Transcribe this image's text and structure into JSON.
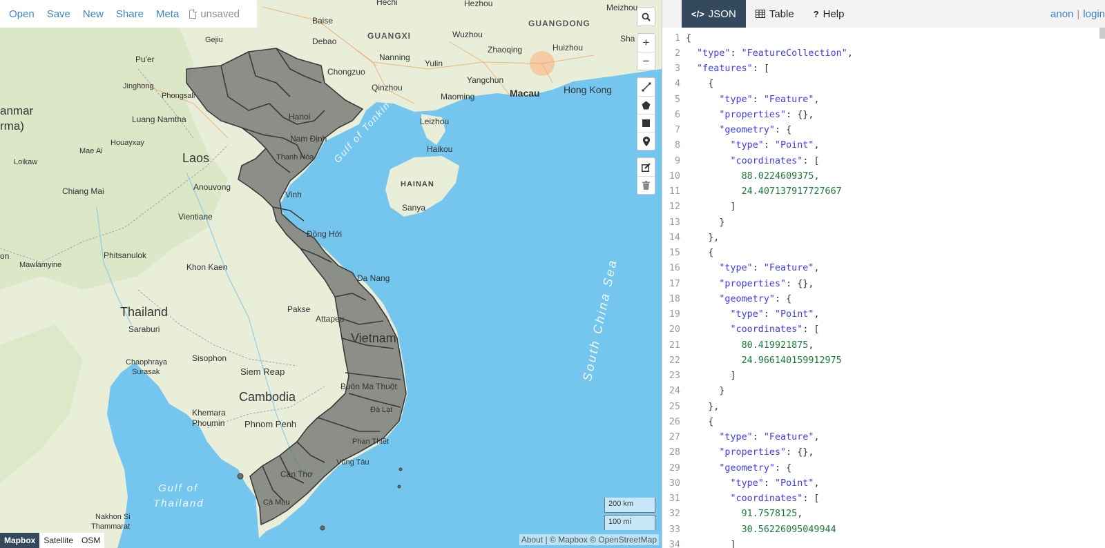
{
  "toolbar": {
    "open": "Open",
    "save": "Save",
    "new": "New",
    "share": "Share",
    "meta": "Meta",
    "file_status": "unsaved"
  },
  "map": {
    "labels": {
      "hechi": "Hechi",
      "hezhou": "Hezhou",
      "meizhou": "Meizhou",
      "baise": "Baise",
      "guangxi": "GUANGXI",
      "guangdong": "GUANGDONG",
      "gejiu": "Gejiu",
      "debao": "Debao",
      "wuzhou": "Wuzhou",
      "sha": "Sha",
      "puer": "Pu'er",
      "nanning": "Nanning",
      "zhaoqing": "Zhaoqing",
      "huizhou": "Huizhou",
      "chongzuo": "Chongzuo",
      "yulin": "Yulin",
      "jinghong": "Jinghong",
      "phongsali": "Phongsali",
      "qinzhou": "Qinzhou",
      "yangchun": "Yangchun",
      "macau": "Macau",
      "hongkong": "Hong Kong",
      "maoming": "Maoming",
      "myanmar": "anmar",
      "burma": "rma)",
      "luangnamtha": "Luang Namtha",
      "leizhou": "Leizhou",
      "hanoi": "Hanoi",
      "namdinh": "Nam Định",
      "houayxay": "Houayxay",
      "gulf_tonkin": "Gulf of Tonkin",
      "haikou": "Haikou",
      "maeai": "Mae Ai",
      "laos": "Laos",
      "loikaw": "Loikaw",
      "thanhhoa": "Thanh Hóa",
      "hainan": "HAINAN",
      "anouvong": "Anouvong",
      "chiangmai": "Chiang Mai",
      "vinh": "Vinh",
      "sanya": "Sanya",
      "vientiane": "Vientiane",
      "donghoi": "Đồng Hới",
      "phitsanulok": "Phitsanulok",
      "mawlamyine": "Mawlamyine",
      "khonkaen": "Khon Kaen",
      "danang": "Da Nang",
      "south_china_sea": "South China Sea",
      "thailand": "Thailand",
      "pakse": "Pakse",
      "attapeu": "Attapeu",
      "saraburi": "Saraburi",
      "vietnam": "Vietnam",
      "sisophon": "Sisophon",
      "chaophraya": "Chaophraya",
      "surasak": "Surasak",
      "siemreap": "Siem Reap",
      "buonmathuot": "Buôn Ma Thuột",
      "cambodia": "Cambodia",
      "dalat": "Đà Lạt",
      "khemara": "Khemara",
      "phoumin": "Phoumin",
      "phnompenh": "Phnom Penh",
      "phanthiet": "Phan Thiết",
      "vungtau": "Vũng Tàu",
      "cantho": "Cần Thơ",
      "gulf_thailand_1": "Gulf of",
      "gulf_thailand_2": "Thailand",
      "camau": "Cà Mau",
      "nakhonsi": "Nakhon Si",
      "thammarat": "Thammarat",
      "on": "on"
    },
    "scale_km": "200 km",
    "scale_mi": "100 mi",
    "layers": [
      "Mapbox",
      "Satellite",
      "OSM"
    ],
    "attribution": "About | © Mapbox © OpenStreetMap",
    "colors": {
      "water": "#74c6ee",
      "land": "#e8eed8",
      "region_fill": "#6e6e6e",
      "region_stroke": "#3a3a3a"
    }
  },
  "panel": {
    "tabs": [
      {
        "label": "JSON",
        "icon": "code-icon",
        "active": true
      },
      {
        "label": "Table",
        "icon": "table-icon",
        "active": false
      },
      {
        "label": "Help",
        "icon": "question-icon",
        "active": false
      }
    ],
    "user": "anon",
    "login": "login",
    "code_lines": [
      "{",
      "  \"type\": \"FeatureCollection\",",
      "  \"features\": [",
      "    {",
      "      \"type\": \"Feature\",",
      "      \"properties\": {},",
      "      \"geometry\": {",
      "        \"type\": \"Point\",",
      "        \"coordinates\": [",
      "          88.0224609375,",
      "          24.407137917727667",
      "        ]",
      "      }",
      "    },",
      "    {",
      "      \"type\": \"Feature\",",
      "      \"properties\": {},",
      "      \"geometry\": {",
      "        \"type\": \"Point\",",
      "        \"coordinates\": [",
      "          80.419921875,",
      "          24.966140159912975",
      "        ]",
      "      }",
      "    },",
      "    {",
      "      \"type\": \"Feature\",",
      "      \"properties\": {},",
      "      \"geometry\": {",
      "        \"type\": \"Point\",",
      "        \"coordinates\": [",
      "          91.7578125,",
      "          30.56226095049944",
      "        ]"
    ]
  }
}
